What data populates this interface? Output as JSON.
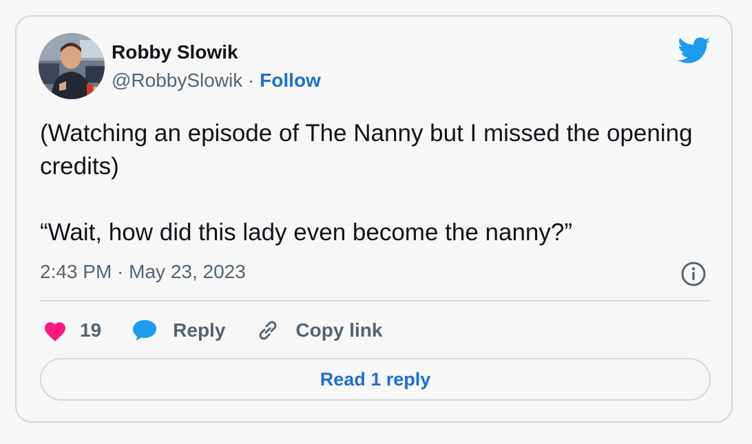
{
  "author": {
    "name": "Robby Slowik",
    "handle": "@RobbySlowik",
    "separator": " · ",
    "follow_label": "Follow"
  },
  "tweet": {
    "text": "(Watching an episode of The Nanny but I missed the opening credits)\n\n“Wait, how did this lady even become the nanny?”",
    "timestamp": "2:43 PM · May 23, 2023"
  },
  "actions": {
    "like_count": "19",
    "reply_label": "Reply",
    "copy_link_label": "Copy link"
  },
  "read_replies_label": "Read 1 reply",
  "icons": {
    "brand": "twitter-bird-icon",
    "info": "info-icon",
    "like": "heart-icon",
    "reply": "speech-bubble-icon",
    "copy_link": "link-icon"
  },
  "colors": {
    "twitter_blue": "#1d9bf0",
    "link_blue": "#1d6fd1",
    "heart_pink": "#f91880",
    "text_primary": "#0f1419",
    "text_secondary": "#536471",
    "border": "#cfd9de",
    "background": "#f7f7f7"
  }
}
